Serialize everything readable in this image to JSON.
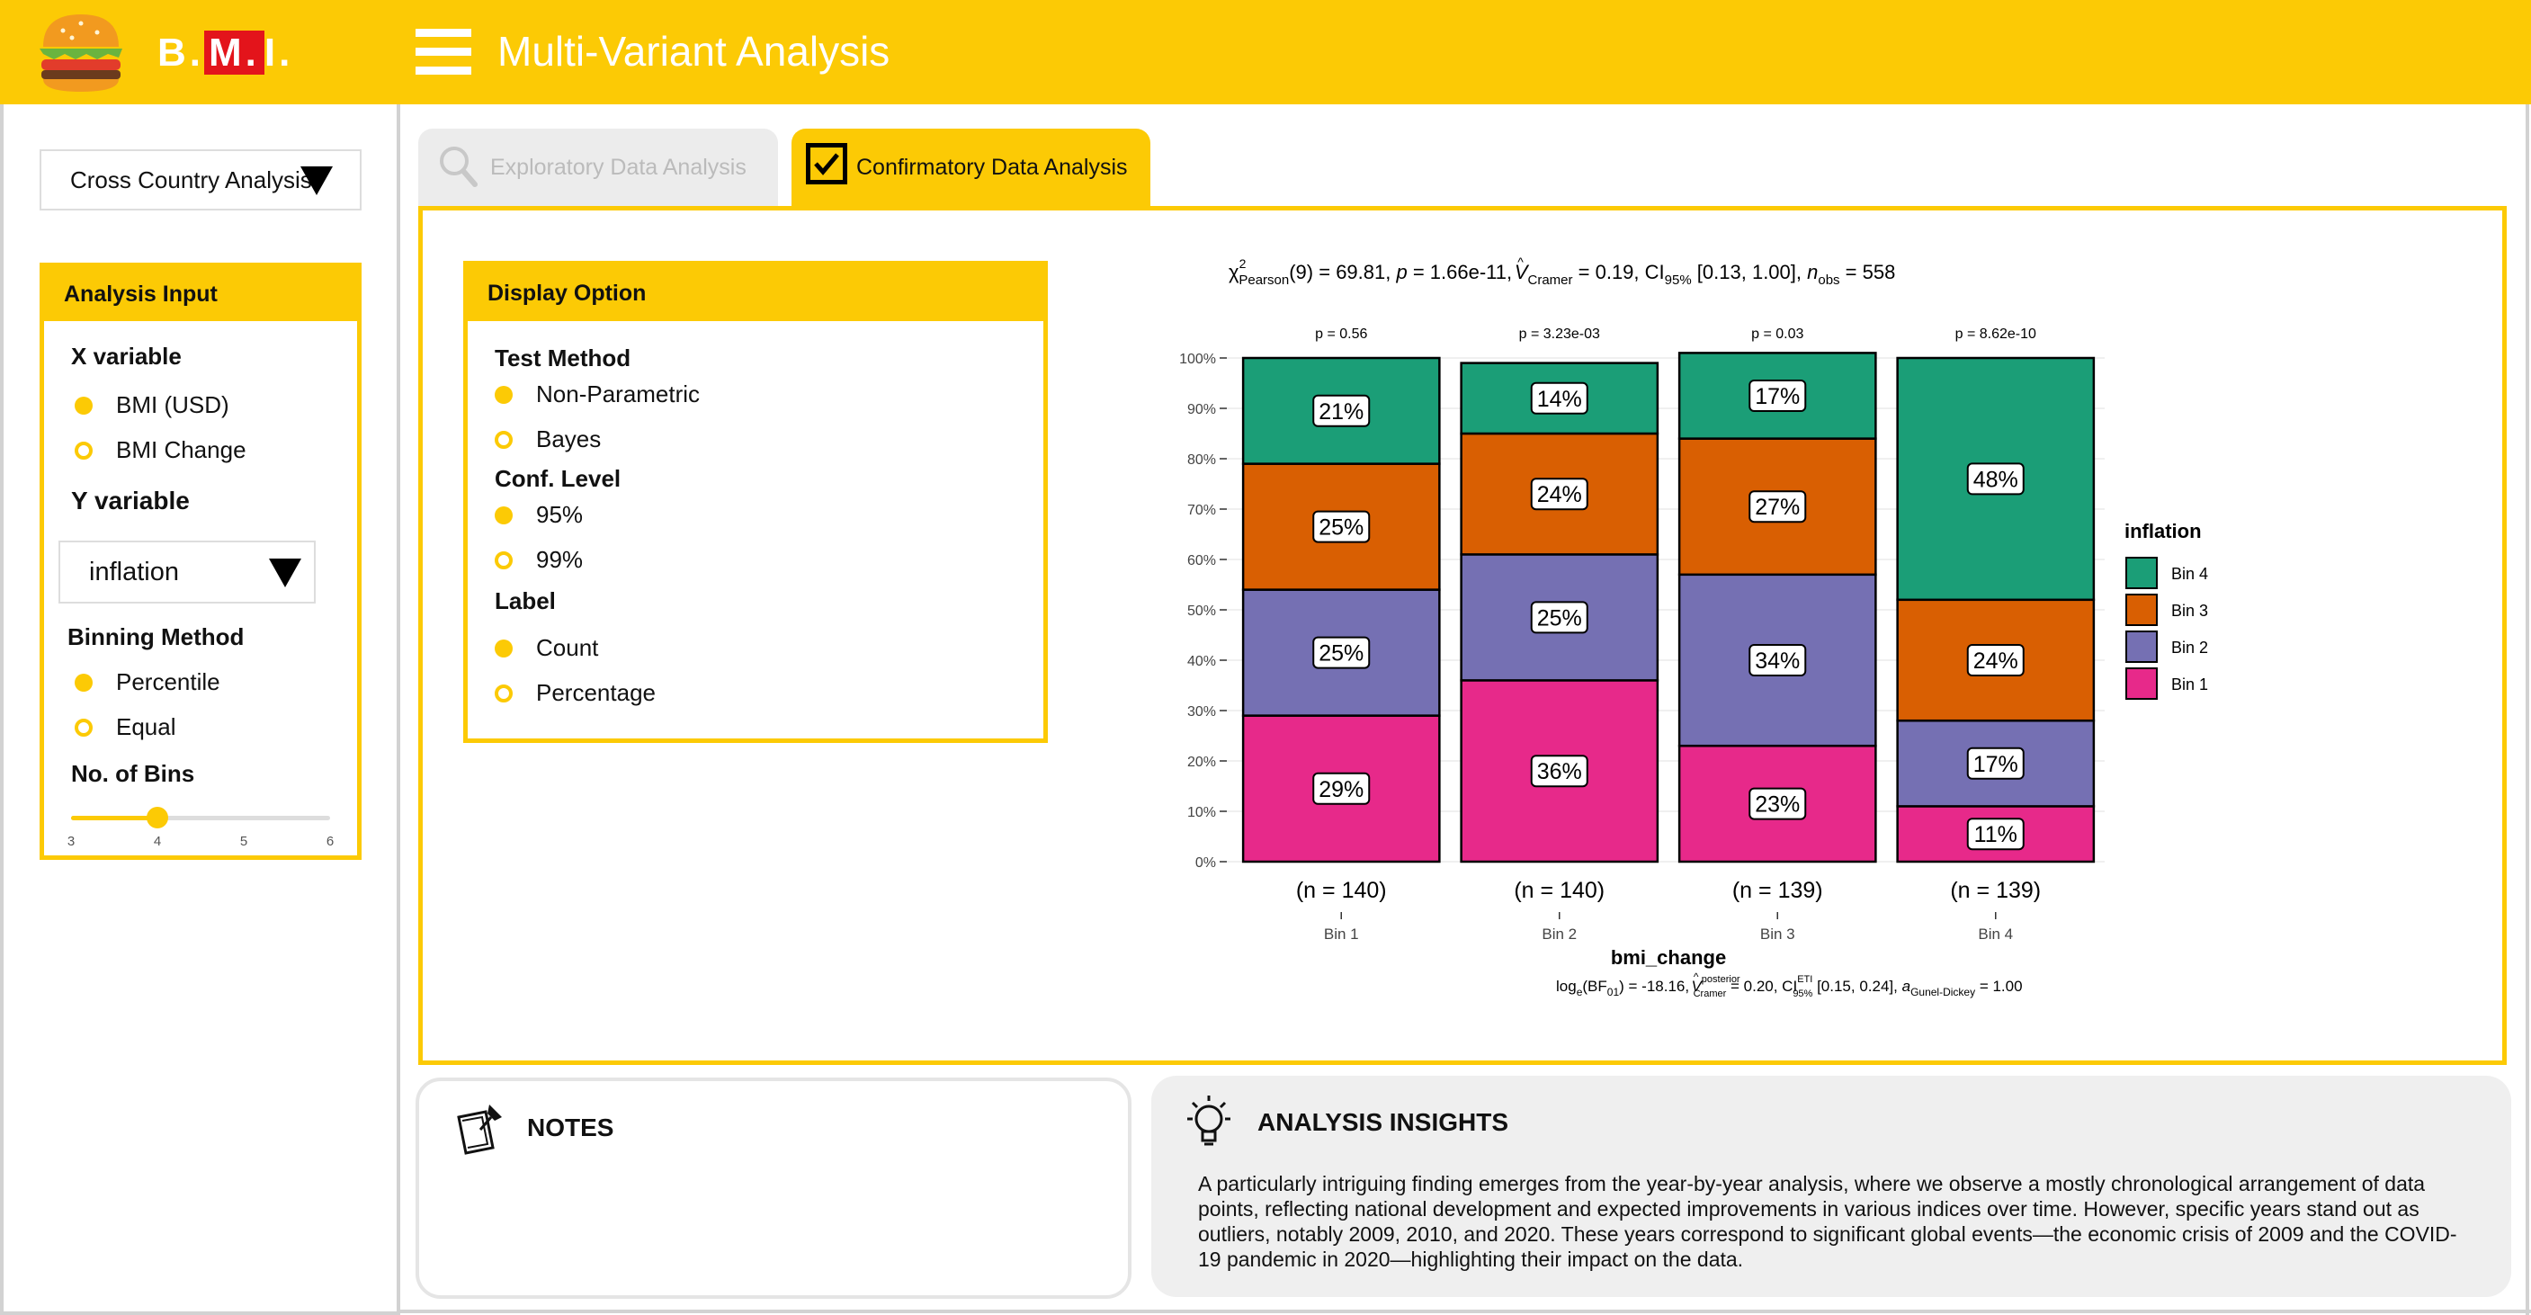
{
  "header": {
    "brand": {
      "pre": "B.",
      "hl": "M.",
      "post": "I."
    },
    "title": "Multi-Variant Analysis",
    "color": "#fcca05"
  },
  "sidebar": {
    "country_select": "Cross Country Analysis",
    "analysis_input": {
      "title": "Analysis Input",
      "x_label": "X variable",
      "x_options": [
        {
          "label": "BMI (USD)",
          "selected": true
        },
        {
          "label": "BMI Change",
          "selected": false
        }
      ],
      "y_label": "Y variable",
      "y_value": "inflation",
      "binning_label": "Binning Method",
      "binning_options": [
        {
          "label": "Percentile",
          "selected": true
        },
        {
          "label": "Equal",
          "selected": false
        }
      ],
      "bins_label": "No. of Bins",
      "bins_slider": {
        "min": 3,
        "max": 6,
        "value": 4,
        "ticks": [
          "3",
          "4",
          "5",
          "6"
        ]
      }
    }
  },
  "tabs": [
    {
      "label": "Exploratory Data Analysis",
      "active": false
    },
    {
      "label": "Confirmatory Data Analysis",
      "active": true
    }
  ],
  "display_option": {
    "title": "Display Option",
    "test_method_label": "Test Method",
    "test_methods": [
      {
        "label": "Non-Parametric",
        "selected": true
      },
      {
        "label": "Bayes",
        "selected": false
      }
    ],
    "conf_level_label": "Conf. Level",
    "conf_levels": [
      {
        "label": "95%",
        "selected": true
      },
      {
        "label": "99%",
        "selected": false
      }
    ],
    "label_label": "Label",
    "labels": [
      {
        "label": "Count",
        "selected": true
      },
      {
        "label": "Percentage",
        "selected": false
      }
    ]
  },
  "chart_data": {
    "type": "bar",
    "stacked": true,
    "subtitle": {
      "chi": "χ",
      "chi_sup": "2",
      "chi_sub": "Pearson",
      "stat": "(9) = 69.81, ",
      "p_lbl": "p",
      "p_val": " = 1.66e-11, ",
      "v_lbl": "V",
      "v_hat": "^",
      "v_sub": "Cramer",
      "v_val": " = 0.19, CI",
      "ci_sub": "95%",
      "ci_val": " [0.13, 1.00], ",
      "n_lbl": "n",
      "n_sub": "obs",
      "n_val": " = 558"
    },
    "caption": {
      "log": "log",
      "log_sub": "e",
      "bf": "(BF",
      "bf_sub": "01",
      "bf_val": ") = -18.16, ",
      "v_lbl": "V",
      "v_hat": "^",
      "v_sup": "posterior",
      "v_sub": "Cramer",
      "v_val": " = 0.20, CI",
      "ci_sup": "ETI",
      "ci_sub": "95%",
      "ci_val": " [0.15, 0.24], ",
      "a_lbl": "a",
      "a_sub": "Gunel-Dickey",
      "a_val": " = 1.00"
    },
    "xlabel": "bmi_change",
    "categories": [
      "Bin 1",
      "Bin 2",
      "Bin 3",
      "Bin 4"
    ],
    "p_values": [
      "p = 0.56",
      "p = 3.23e-03",
      "p = 0.03",
      "p = 8.62e-10"
    ],
    "n_labels": [
      "(n = 140)",
      "(n = 140)",
      "(n = 139)",
      "(n = 139)"
    ],
    "ylim": [
      0,
      100
    ],
    "yticks": [
      "0%",
      "10%",
      "20%",
      "30%",
      "40%",
      "50%",
      "60%",
      "70%",
      "80%",
      "90%",
      "100%"
    ],
    "legend_title": "inflation",
    "legend_position": "right",
    "series": [
      {
        "name": "Bin 1",
        "color": "#e7298a",
        "values": [
          29,
          36,
          23,
          11
        ],
        "labels": [
          "29%",
          "36%",
          "23%",
          "11%"
        ]
      },
      {
        "name": "Bin 2",
        "color": "#7570b3",
        "values": [
          25,
          25,
          34,
          17
        ],
        "labels": [
          "25%",
          "25%",
          "34%",
          "17%"
        ]
      },
      {
        "name": "Bin 3",
        "color": "#d95f02",
        "values": [
          25,
          24,
          27,
          24
        ],
        "labels": [
          "25%",
          "24%",
          "27%",
          "24%"
        ]
      },
      {
        "name": "Bin 4",
        "color": "#1b9e77",
        "values": [
          21,
          14,
          17,
          48
        ],
        "labels": [
          "21%",
          "14%",
          "17%",
          "48%"
        ]
      }
    ]
  },
  "notes": {
    "title": "NOTES"
  },
  "insights": {
    "title": "ANALYSIS INSIGHTS",
    "text": "A particularly intriguing finding emerges from the year-by-year analysis, where we observe a mostly chronological arrangement of data points, reflecting national development and expected improvements in various indices over time. However, specific years stand out as outliers, notably 2009, 2010, and 2020. These years correspond to significant global events—the economic crisis of 2009 and the COVID-19 pandemic in 2020—highlighting their impact on the data."
  }
}
